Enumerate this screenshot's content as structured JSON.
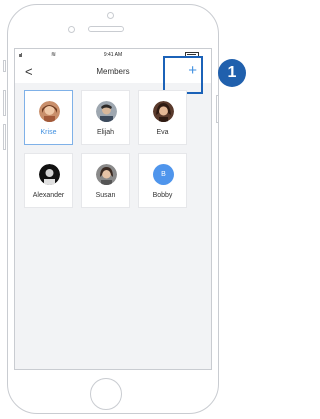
{
  "status_bar": {
    "signal": "ııl",
    "time": "9:41 AM"
  },
  "nav": {
    "back_symbol": "<",
    "title": "Members",
    "add_symbol": "+"
  },
  "members": [
    {
      "name": "Krise",
      "selected": true,
      "avatar": "photo"
    },
    {
      "name": "Elijah",
      "selected": false,
      "avatar": "photo"
    },
    {
      "name": "Eva",
      "selected": false,
      "avatar": "photo"
    },
    {
      "name": "Alexander",
      "selected": false,
      "avatar": "photo"
    },
    {
      "name": "Susan",
      "selected": false,
      "avatar": "photo"
    },
    {
      "name": "Bobby",
      "selected": false,
      "avatar": "letter",
      "initial": "B"
    }
  ],
  "callout": {
    "number": "1"
  },
  "colors": {
    "accent": "#3f8fe0",
    "callout": "#2060ad",
    "avatar_letter_bg": "#4f95ec"
  }
}
